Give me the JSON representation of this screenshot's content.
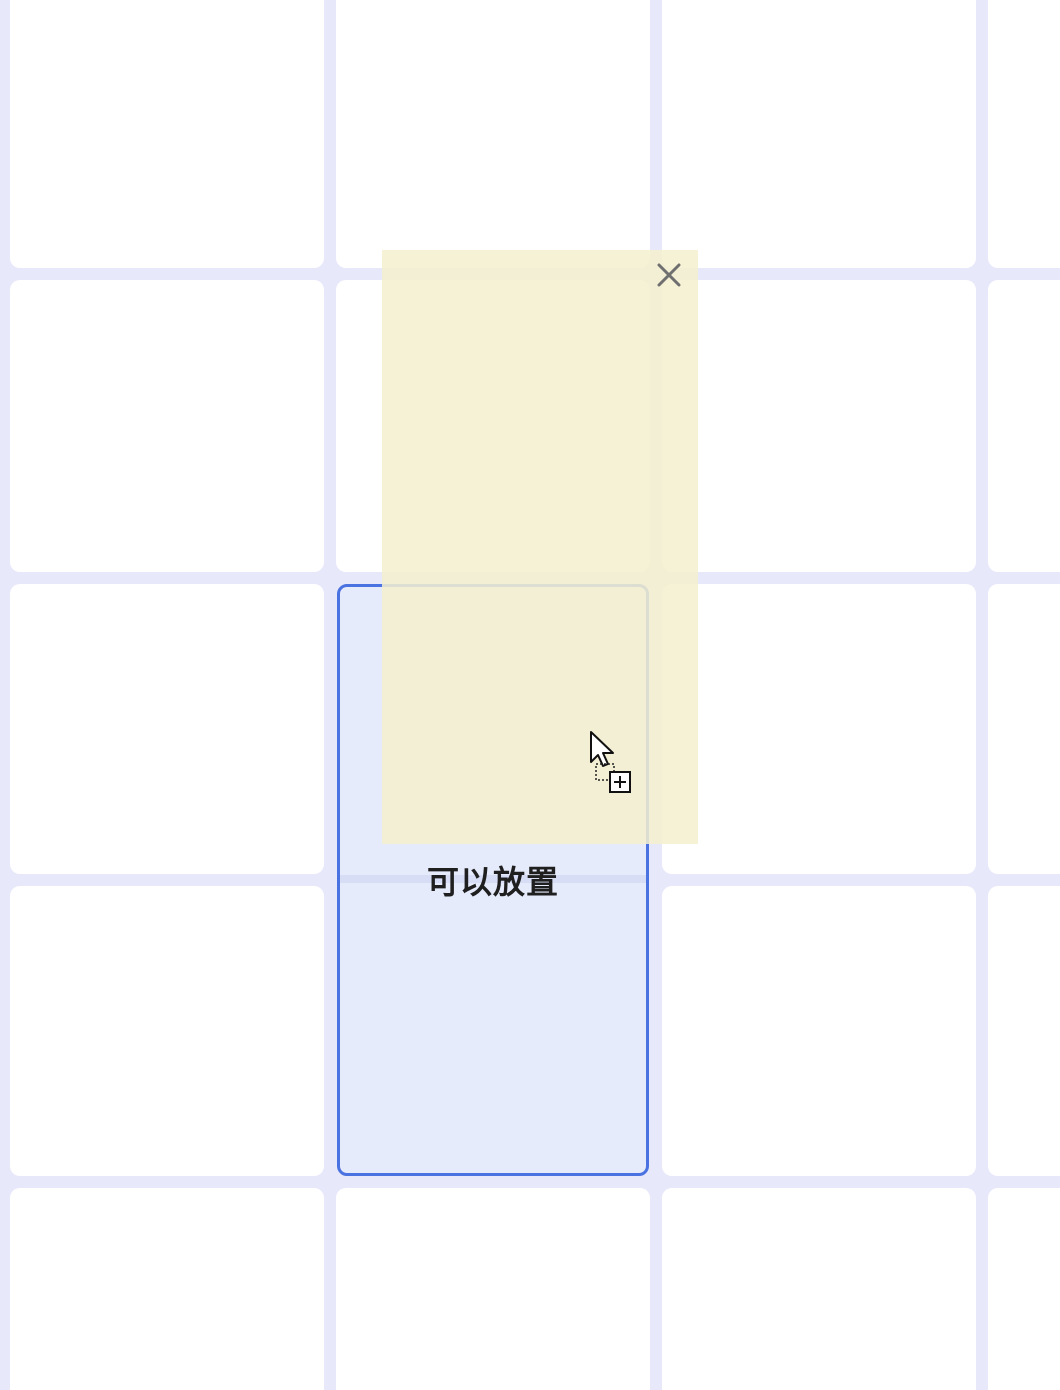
{
  "board": {
    "columns": 4,
    "rows": 5,
    "background_color": "#e8e8fb",
    "cell_color": "#ffffff"
  },
  "drop_zone": {
    "label": "可以放置",
    "border_color": "#4a72e0",
    "fill_color": "#e6ebfc",
    "state": "valid-drop"
  },
  "drag_card": {
    "fill_color": "#f5f0ce",
    "close_icon": "close-icon"
  },
  "cursor": {
    "icon": "copy-drag-cursor-icon"
  }
}
